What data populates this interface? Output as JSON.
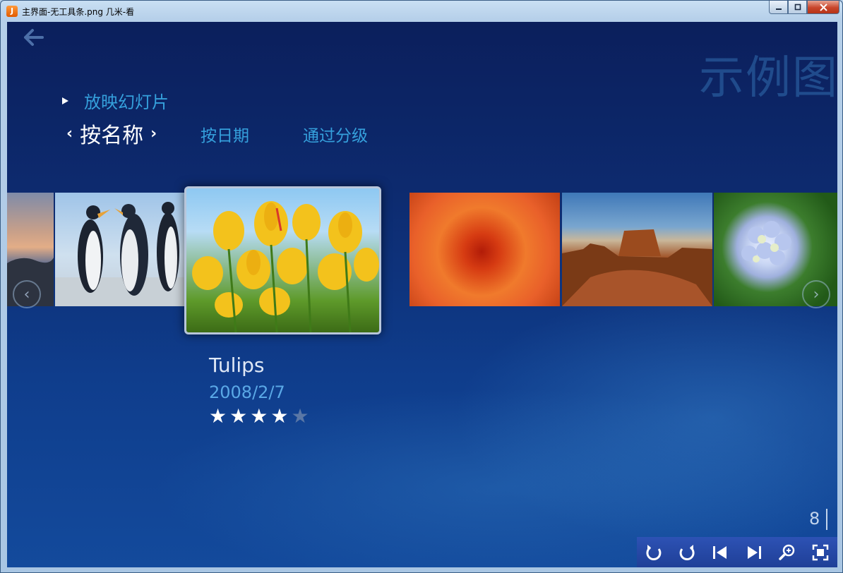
{
  "window": {
    "app_icon": "jimi-app-icon",
    "title": "主界面-无工具条.png  几米-看",
    "buttons": {
      "minimize": "minimize-icon",
      "maximize": "maximize-icon",
      "close": "close-icon"
    }
  },
  "nav": {
    "back_icon": "back-arrow-icon"
  },
  "gallery": {
    "title": "示例图",
    "slideshow_label": "放映幻灯片",
    "sort": {
      "active": "按名称",
      "options": [
        "按日期",
        "通过分级"
      ]
    },
    "thumbnails": [
      "sunset",
      "penguins",
      "tulips",
      "chrysanthemum",
      "desert",
      "hydrangea"
    ],
    "selected": {
      "name": "Tulips",
      "date": "2008/2/7",
      "rating": 4,
      "rating_max": 5
    },
    "page_number": "8"
  },
  "toolbar": {
    "buttons": [
      "rotate-left-icon",
      "rotate-right-icon",
      "previous-icon",
      "next-icon",
      "zoom-icon",
      "fullscreen-icon"
    ]
  },
  "colors": {
    "accent": "#35a0dc",
    "background": "#0d2a6e",
    "toolbar": "#2447a6"
  }
}
